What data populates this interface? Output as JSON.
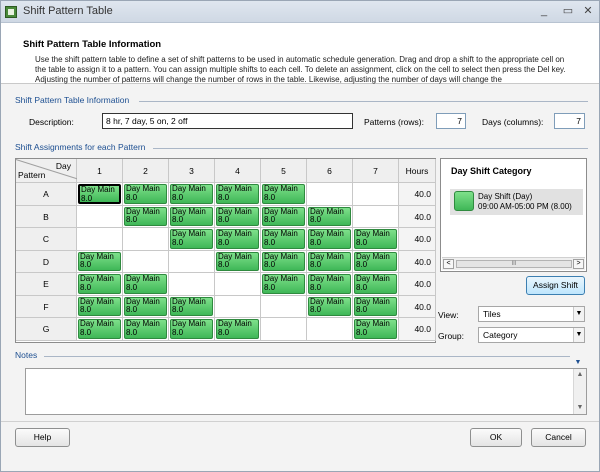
{
  "window": {
    "title": "Shift Pattern Table",
    "minimize": "_",
    "maximize": "▭",
    "close": "✕"
  },
  "header": {
    "title": "Shift Pattern Table Information",
    "description": "Use the shift pattern table to define a set of shift patterns to be used in automatic schedule generation. Drag and drop a shift to the appropriate cell on the table to assign it to a pattern. You can assign multiple shifts to each cell. To delete an assignment, click on the cell to select then press the Del key.  Adjusting the number of patterns will change the number of rows in the table. Likewise, adjusting the number of days will change the"
  },
  "info_section": {
    "label": "Shift Pattern Table Information",
    "description_label": "Description:",
    "description_value": "8 hr, 7 day, 5 on, 2 off",
    "patterns_label": "Patterns (rows):",
    "patterns_value": "7",
    "days_label": "Days (columns):",
    "days_value": "7"
  },
  "assign_section": {
    "label": "Shift Assignments for each Pattern"
  },
  "grid": {
    "corner_day": "Day",
    "corner_pattern": "Pattern",
    "day_headers": [
      "1",
      "2",
      "3",
      "4",
      "5",
      "6",
      "7"
    ],
    "hours_header": "Hours",
    "shift_line1": "Day Main",
    "shift_line2": "8.0",
    "rows": [
      {
        "label": "A",
        "hours": "40.0",
        "days": [
          true,
          true,
          true,
          true,
          true,
          false,
          false
        ]
      },
      {
        "label": "B",
        "hours": "40.0",
        "days": [
          false,
          true,
          true,
          true,
          true,
          true,
          false
        ]
      },
      {
        "label": "C",
        "hours": "40.0",
        "days": [
          false,
          false,
          true,
          true,
          true,
          true,
          true
        ]
      },
      {
        "label": "D",
        "hours": "40.0",
        "days": [
          true,
          false,
          false,
          true,
          true,
          true,
          true
        ]
      },
      {
        "label": "E",
        "hours": "40.0",
        "days": [
          true,
          true,
          false,
          false,
          true,
          true,
          true
        ]
      },
      {
        "label": "F",
        "hours": "40.0",
        "days": [
          true,
          true,
          true,
          false,
          false,
          true,
          true
        ]
      },
      {
        "label": "G",
        "hours": "40.0",
        "days": [
          true,
          true,
          true,
          true,
          false,
          false,
          true
        ]
      }
    ]
  },
  "category_panel": {
    "title": "Day Shift Category",
    "item_name": "Day Shift (Day)",
    "item_time": "09:00 AM-05:00 PM (8.00)",
    "scroll_left": "<",
    "scroll_right": ">",
    "scroll_grip": "III"
  },
  "assign_button": "Assign Shift",
  "view": {
    "label": "View:",
    "value": "Tiles"
  },
  "group": {
    "label": "Group:",
    "value": "Category"
  },
  "notes_section": {
    "label": "Notes"
  },
  "footer": {
    "help": "Help",
    "ok": "OK",
    "cancel": "Cancel"
  },
  "colors": {
    "shift_green": "#4cc463",
    "section_blue": "#1d4f91"
  },
  "icons": {
    "window": "shift-pattern-app-icon",
    "dropdown": "chevron-down-icon"
  }
}
